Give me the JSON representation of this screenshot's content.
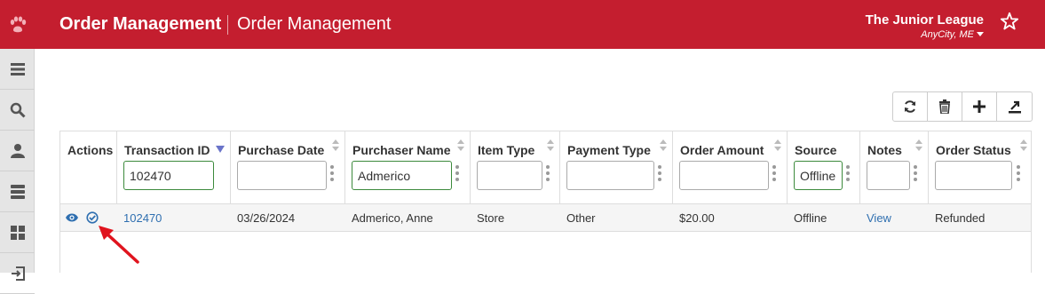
{
  "header": {
    "title": "Order Management",
    "subtitle": "Order Management",
    "org_name": "The Junior League",
    "org_location": "AnyCity, ME",
    "logo_icon": "paw-icon",
    "favorite_icon": "star-icon",
    "color": "#c41e2f"
  },
  "sidebar": {
    "items": [
      {
        "icon": "menu-icon"
      },
      {
        "icon": "search-icon"
      },
      {
        "icon": "user-icon"
      },
      {
        "icon": "server-icon"
      },
      {
        "icon": "dashboard-icon"
      },
      {
        "icon": "logout-icon"
      }
    ]
  },
  "toolbar": {
    "buttons": [
      {
        "icon": "refresh-icon"
      },
      {
        "icon": "trash-icon"
      },
      {
        "icon": "plus-icon"
      },
      {
        "icon": "export-icon"
      }
    ]
  },
  "table": {
    "columns": [
      {
        "label": "Actions"
      },
      {
        "label": "Transaction ID",
        "filter": "102470",
        "sorted": "desc"
      },
      {
        "label": "Purchase Date",
        "filter": ""
      },
      {
        "label": "Purchaser Name",
        "filter": "Admerico"
      },
      {
        "label": "Item Type",
        "filter": ""
      },
      {
        "label": "Payment Type",
        "filter": ""
      },
      {
        "label": "Order Amount",
        "filter": ""
      },
      {
        "label": "Source",
        "filter": "Offline"
      },
      {
        "label": "Notes",
        "filter": ""
      },
      {
        "label": "Order Status",
        "filter": ""
      }
    ],
    "rows": [
      {
        "transaction_id": "102470",
        "purchase_date": "03/26/2024",
        "purchaser_name": "Admerico, Anne",
        "item_type": "Store",
        "payment_type": "Other",
        "order_amount": "$20.00",
        "source": "Offline",
        "notes": "View",
        "order_status": "Refunded"
      }
    ]
  }
}
